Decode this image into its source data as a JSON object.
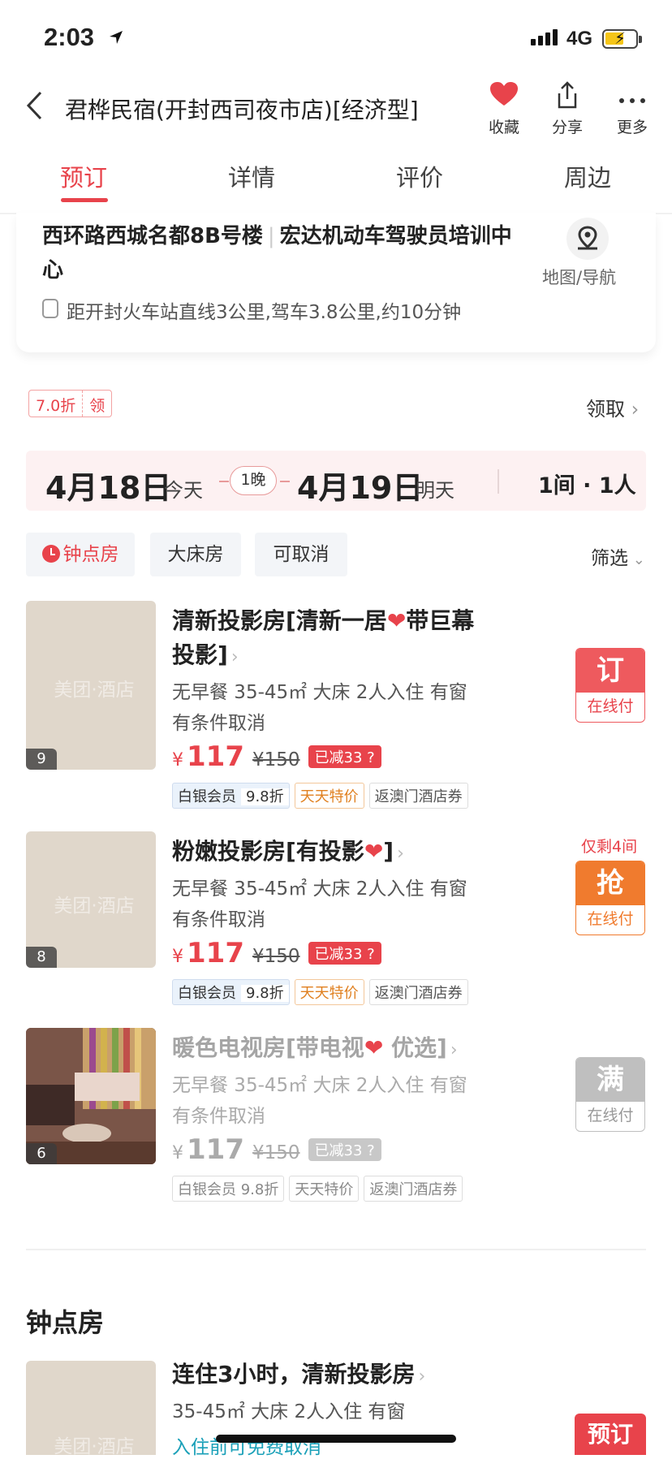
{
  "status": {
    "time": "2:03",
    "network": "4G"
  },
  "header": {
    "title": "君桦民宿(开封西司夜市店)[经济型]",
    "fav_label": "收藏",
    "share_label": "分享",
    "more_label": "更多"
  },
  "tabs": [
    {
      "label": "预订"
    },
    {
      "label": "详情"
    },
    {
      "label": "评价"
    },
    {
      "label": "周边"
    }
  ],
  "address": {
    "line1": "西环路西城名都8B号楼",
    "line1b": "宏达机动车驾驶员培训中心",
    "map_label": "地图/导航",
    "distance": "距开封火车站直线3公里,驾车3.8公里,约10分钟"
  },
  "coupon": {
    "discount": "7.0折",
    "get": "领",
    "claim_label": "领取"
  },
  "dates": {
    "checkin": "4月18日",
    "checkin_sub": "今天",
    "nights": "1晚",
    "checkout": "4月19日",
    "checkout_sub": "明天",
    "rooms": "1间 · 1人"
  },
  "filters": {
    "chips": [
      "钟点房",
      "大床房",
      "可取消"
    ],
    "filter_label": "筛选"
  },
  "watermark": "美团·酒店",
  "rooms": [
    {
      "name_a": "清新投影房[清新一居",
      "name_b": "带巨幕",
      "name_c": "投影]",
      "desc": "无早餐 35-45㎡ 大床 2人入住 有窗",
      "policy": "有条件取消",
      "currency": "¥",
      "price": "117",
      "orig": "¥150",
      "discount": "已减33",
      "tag_silver": "白银会员",
      "tag_silver_val": "9.8折",
      "tag_daily": "天天特价",
      "tag_voucher": "返澳门酒店券",
      "img_count": "9",
      "btn_big": "订",
      "btn_small": "在线付"
    },
    {
      "name_a": "粉嫩投影房[有投影",
      "name_b": "]",
      "desc": "无早餐 35-45㎡ 大床 2人入住 有窗",
      "policy": "有条件取消",
      "currency": "¥",
      "price": "117",
      "orig": "¥150",
      "discount": "已减33",
      "tag_silver": "白银会员",
      "tag_silver_val": "9.8折",
      "tag_daily": "天天特价",
      "tag_voucher": "返澳门酒店券",
      "img_count": "8",
      "remaining": "仅剩4间",
      "btn_big": "抢",
      "btn_small": "在线付"
    },
    {
      "name_a": "暖色电视房[带电视",
      "name_b": " 优选]",
      "desc": "无早餐 35-45㎡ 大床 2人入住 有窗",
      "policy": "有条件取消",
      "currency": "¥",
      "price": "117",
      "orig": "¥150",
      "discount": "已减33",
      "tag_silver": "白银会员",
      "tag_silver_val": "9.8折",
      "tag_daily": "天天特价",
      "tag_voucher": "返澳门酒店券",
      "img_count": "6",
      "btn_big": "满",
      "btn_small": "在线付"
    }
  ],
  "hourly": {
    "section_title": "钟点房",
    "name": "连住3小时，清新投影房",
    "desc": "35-45㎡ 大床 2人入住 有窗",
    "policy": "入住前可免费取消",
    "btn": "预订"
  },
  "colors": {
    "accent": "#e8434b",
    "orange": "#f07b2e",
    "teal": "#1aa0b8"
  }
}
